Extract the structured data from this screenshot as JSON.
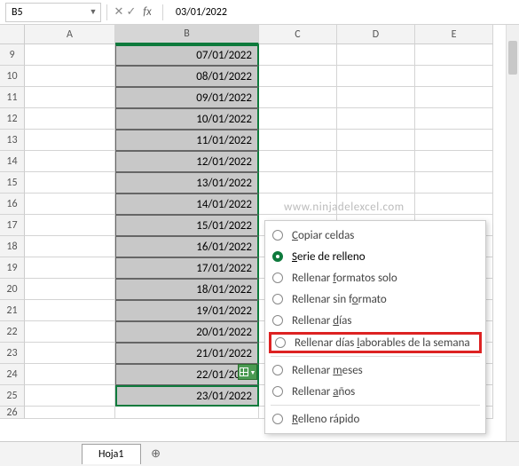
{
  "namebox": {
    "value": "B5"
  },
  "formula_bar": {
    "fx_label": "fx",
    "value": "03/01/2022"
  },
  "columns": {
    "A": "A",
    "B": "B",
    "C": "C",
    "D": "D",
    "E": "E"
  },
  "row_numbers": [
    "9",
    "10",
    "11",
    "12",
    "13",
    "14",
    "15",
    "16",
    "17",
    "18",
    "19",
    "20",
    "21",
    "22",
    "23",
    "24",
    "25",
    "26"
  ],
  "cells_B": [
    "07/01/2022",
    "08/01/2022",
    "09/01/2022",
    "10/01/2022",
    "11/01/2022",
    "12/01/2022",
    "13/01/2022",
    "14/01/2022",
    "15/01/2022",
    "16/01/2022",
    "17/01/2022",
    "18/01/2022",
    "19/01/2022",
    "20/01/2022",
    "21/01/2022",
    "22/01/2022",
    "23/01/2022"
  ],
  "watermark": "www.ninjadelexcel.com",
  "autofill_menu": {
    "items": [
      {
        "label_pre": "",
        "ul": "C",
        "label_post": "opiar celdas",
        "selected": false
      },
      {
        "label_pre": "",
        "ul": "S",
        "label_post": "erie de relleno",
        "selected": true
      },
      {
        "label_pre": "Rellenar ",
        "ul": "f",
        "label_post": "ormatos solo",
        "selected": false
      },
      {
        "label_pre": "Rellenar sin f",
        "ul": "o",
        "label_post": "rmato",
        "selected": false
      },
      {
        "label_pre": "Rellenar ",
        "ul": "d",
        "label_post": "ías",
        "selected": false
      },
      {
        "label_pre": "Rellenar días ",
        "ul": "l",
        "label_post": "aborables de la semana",
        "selected": false,
        "highlighted": true
      },
      {
        "label_pre": "Rellenar ",
        "ul": "m",
        "label_post": "eses",
        "selected": false
      },
      {
        "label_pre": "Rellenar ",
        "ul": "a",
        "label_post": "ños",
        "selected": false
      },
      {
        "label_pre": "",
        "ul": "R",
        "label_post": "elleno rápido",
        "selected": false
      }
    ]
  },
  "sheet_tab": {
    "name": "Hoja1"
  }
}
